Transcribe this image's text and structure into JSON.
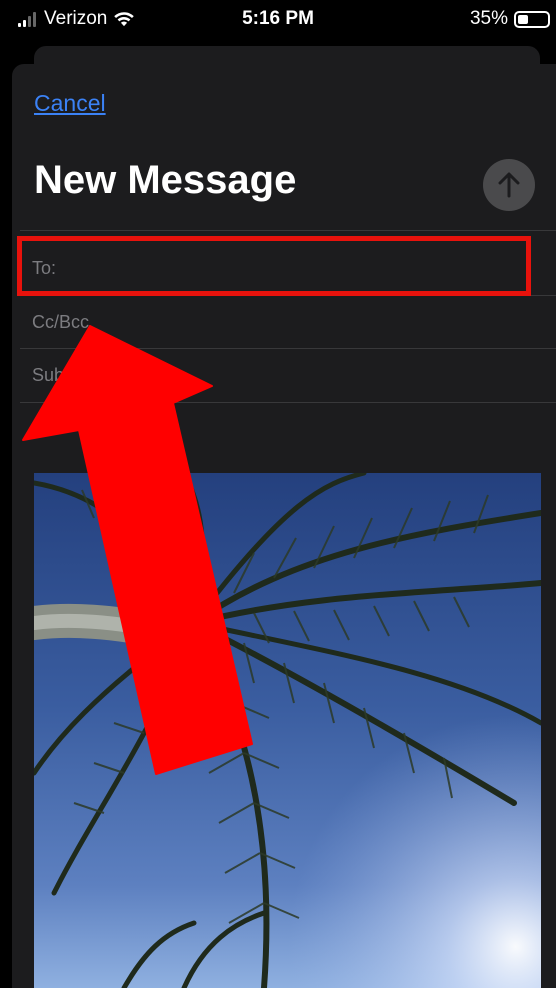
{
  "status_bar": {
    "carrier": "Verizon",
    "time": "5:16 PM",
    "battery_percent": "35%",
    "battery_level": 0.35,
    "signal_icon": "cellular-signal-icon",
    "wifi_icon": "wifi-icon"
  },
  "compose": {
    "cancel_label": "Cancel",
    "title": "New Message",
    "send_icon": "arrow-up-icon",
    "to_label": "To:",
    "ccbcc_label": "Cc/Bcc",
    "subject_label": "Subject"
  },
  "attachment": {
    "kind": "photo",
    "description_icon": "palm-tree-photo"
  },
  "annotations": {
    "highlight_color": "#e8120c",
    "arrow_color": "#ff0000"
  },
  "colors": {
    "accent": "#3b82f6",
    "sheet_background": "#1c1c1e",
    "placeholder_text": "#7c7c80"
  }
}
